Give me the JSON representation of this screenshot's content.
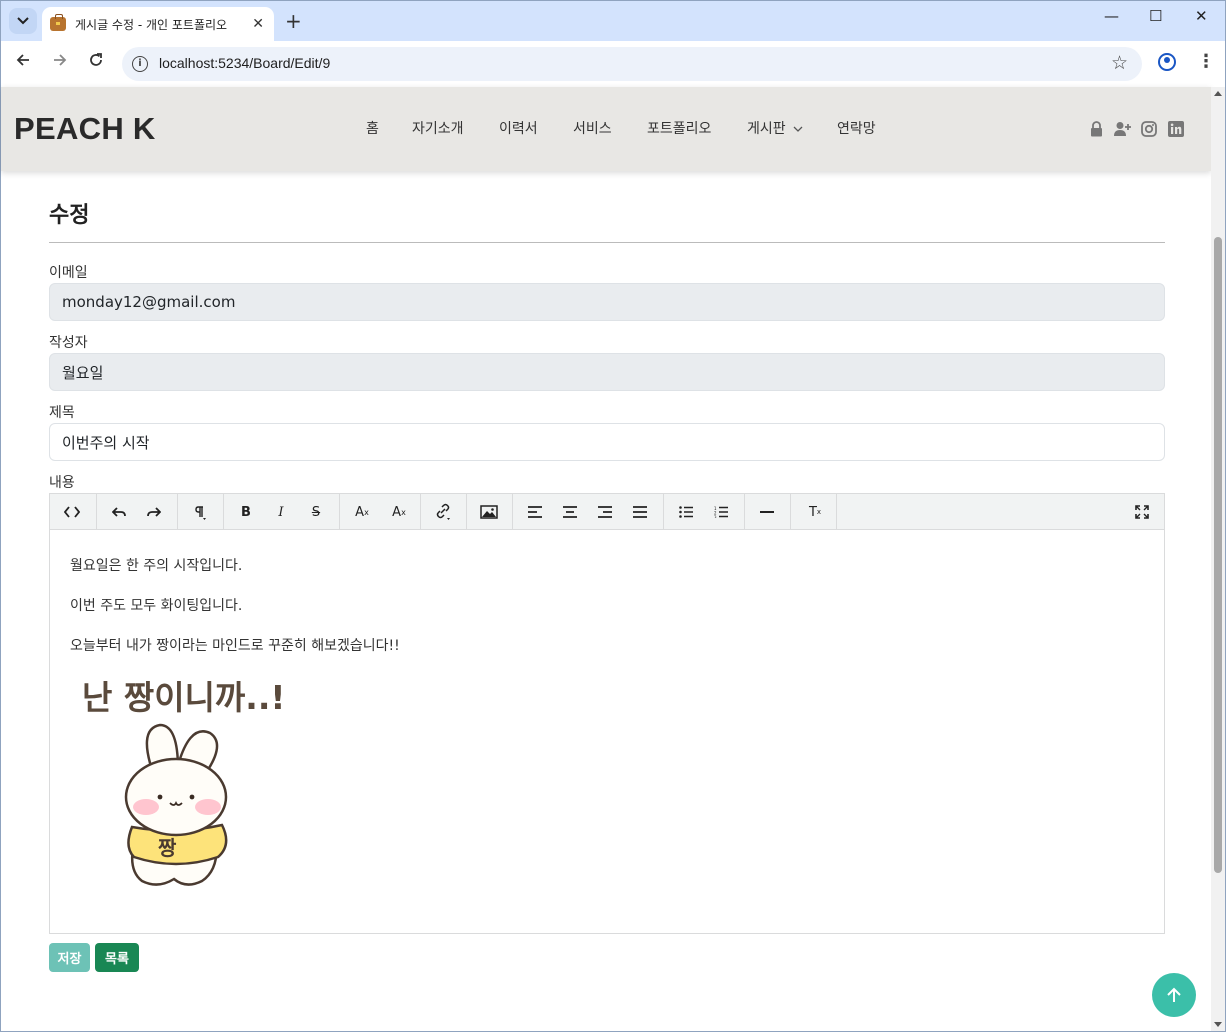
{
  "browser": {
    "tab_title": "게시글 수정 - 개인 포트폴리오",
    "tab_close": "✕",
    "new_tab": "+",
    "url": "localhost:5234/Board/Edit/9",
    "window_controls": [
      "—",
      "☐",
      "✕"
    ]
  },
  "header": {
    "logo": "PEACH K",
    "nav": [
      "홈",
      "자기소개",
      "이력서",
      "서비스",
      "포트폴리오",
      "게시판",
      "연락망"
    ],
    "nav_dropdown_index": 5,
    "icons": [
      "lock-icon",
      "user-plus-icon",
      "instagram-icon",
      "linkedin-icon"
    ]
  },
  "form": {
    "title": "수정",
    "email_label": "이메일",
    "email_value": "monday12@gmail.com",
    "author_label": "작성자",
    "author_value": "월요일",
    "subject_label": "제목",
    "subject_value": "이번주의 시작",
    "content_label": "내용",
    "content_paragraphs": [
      "월요일은 한 주의 시작입니다.",
      "이번 주도 모두 화이팅입니다.",
      "오늘부터 내가 짱이라는 마인드로 꾸준히 해보겠습니다!!"
    ],
    "sticker_caption": "난 짱이니까..!",
    "sticker_shirt_text": "짱",
    "save_label": "저장",
    "list_label": "목록"
  },
  "toolbar_buttons": [
    "code-view",
    "undo",
    "redo",
    "paragraph",
    "bold",
    "italic",
    "strikethrough",
    "superscript",
    "subscript",
    "link",
    "image",
    "align-left",
    "align-center",
    "align-right",
    "align-justify",
    "bullet-list",
    "numbered-list",
    "horizontal-rule",
    "clear-format",
    "fullscreen"
  ],
  "colors": {
    "header_bg": "#e8e7e4",
    "save_button": "#6dc2b6",
    "list_button": "#198754",
    "top_button": "#3bbfa9"
  }
}
